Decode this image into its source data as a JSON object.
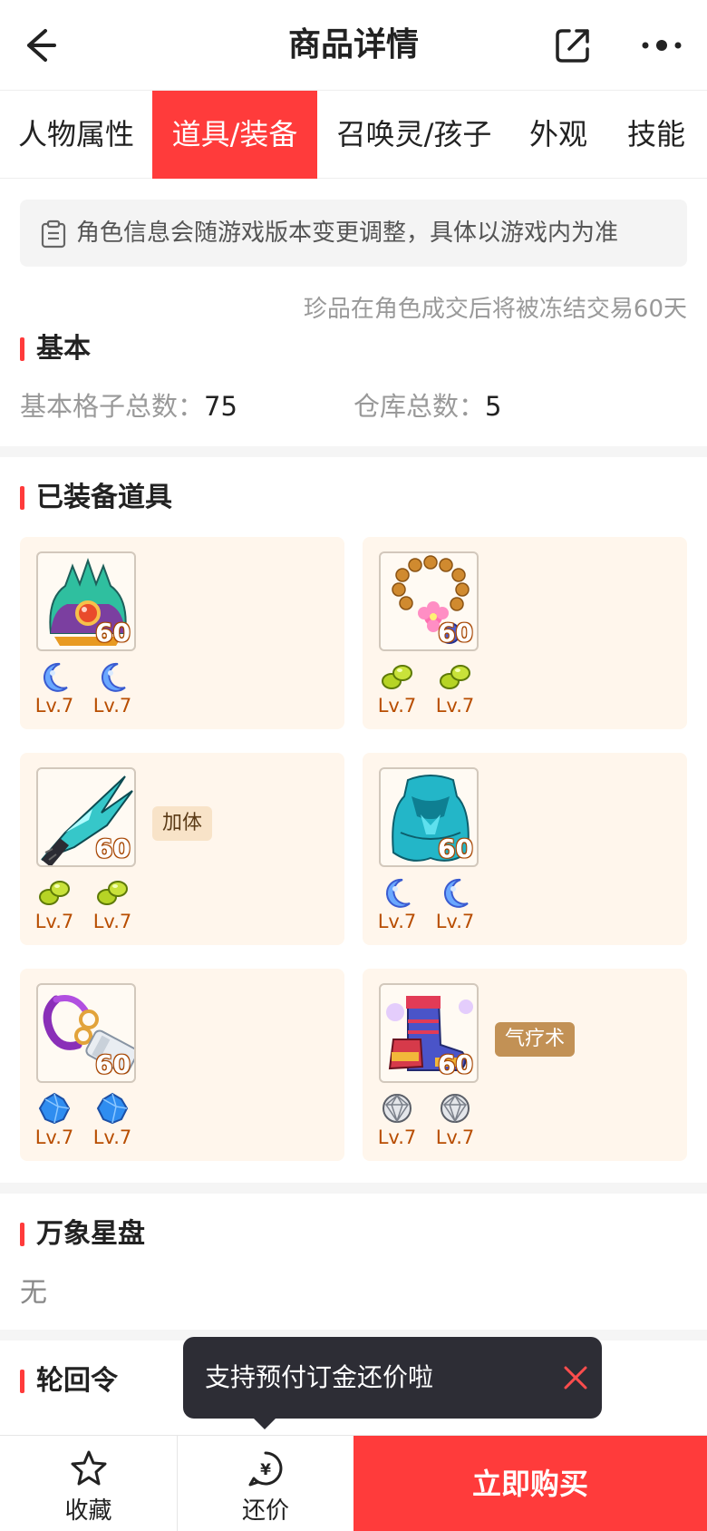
{
  "header": {
    "title": "商品详情"
  },
  "tabs": [
    {
      "label": "人物属性",
      "active": false
    },
    {
      "label": "道具/装备",
      "active": true
    },
    {
      "label": "召唤灵/孩子",
      "active": false
    },
    {
      "label": "外观",
      "active": false
    },
    {
      "label": "技能",
      "active": false
    }
  ],
  "notice": {
    "text": "角色信息会随游戏版本变更调整，具体以游戏内为准"
  },
  "freeze_note": "珍品在角色成交后将被冻结交易60天",
  "basic": {
    "title": "基本",
    "slots_label": "基本格子总数：",
    "slots_value": "75",
    "warehouse_label": "仓库总数：",
    "warehouse_value": "5"
  },
  "equipped": {
    "title": "已装备道具",
    "items": [
      {
        "icon": "helmet-icon",
        "level": "60",
        "tag": "",
        "gems": [
          {
            "icon": "moon-gem-icon",
            "label": "Lv.7"
          },
          {
            "icon": "moon-gem-icon",
            "label": "Lv.7"
          }
        ]
      },
      {
        "icon": "necklace-icon",
        "level": "60",
        "tag": "",
        "gems": [
          {
            "icon": "green-gem-icon",
            "label": "Lv.7"
          },
          {
            "icon": "green-gem-icon",
            "label": "Lv.7"
          }
        ]
      },
      {
        "icon": "claw-weapon-icon",
        "level": "60",
        "tag": "加体",
        "gems": [
          {
            "icon": "green-gem-icon",
            "label": "Lv.7"
          },
          {
            "icon": "green-gem-icon",
            "label": "Lv.7"
          }
        ]
      },
      {
        "icon": "armor-icon",
        "level": "60",
        "tag": "",
        "gems": [
          {
            "icon": "moon-gem-icon",
            "label": "Lv.7"
          },
          {
            "icon": "moon-gem-icon",
            "label": "Lv.7"
          }
        ]
      },
      {
        "icon": "belt-icon",
        "level": "60",
        "tag": "",
        "gems": [
          {
            "icon": "blue-crystal-icon",
            "label": "Lv.7"
          },
          {
            "icon": "blue-crystal-icon",
            "label": "Lv.7"
          }
        ]
      },
      {
        "icon": "boots-icon",
        "level": "60",
        "tag": "气疗术",
        "gems": [
          {
            "icon": "silver-gem-icon",
            "label": "Lv.7"
          },
          {
            "icon": "silver-gem-icon",
            "label": "Lv.7"
          }
        ]
      }
    ]
  },
  "star_disk": {
    "title": "万象星盘",
    "value": "无"
  },
  "reincarnation": {
    "title": "轮回令"
  },
  "toast": {
    "text": "支持预付订金还价啦"
  },
  "bottom": {
    "favorite_label": "收藏",
    "bargain_label": "还价",
    "buy_label": "立即购买"
  },
  "colors": {
    "accent": "#ff3b3b",
    "card_bg": "#fff6ec",
    "level_text": "#b84d00"
  }
}
